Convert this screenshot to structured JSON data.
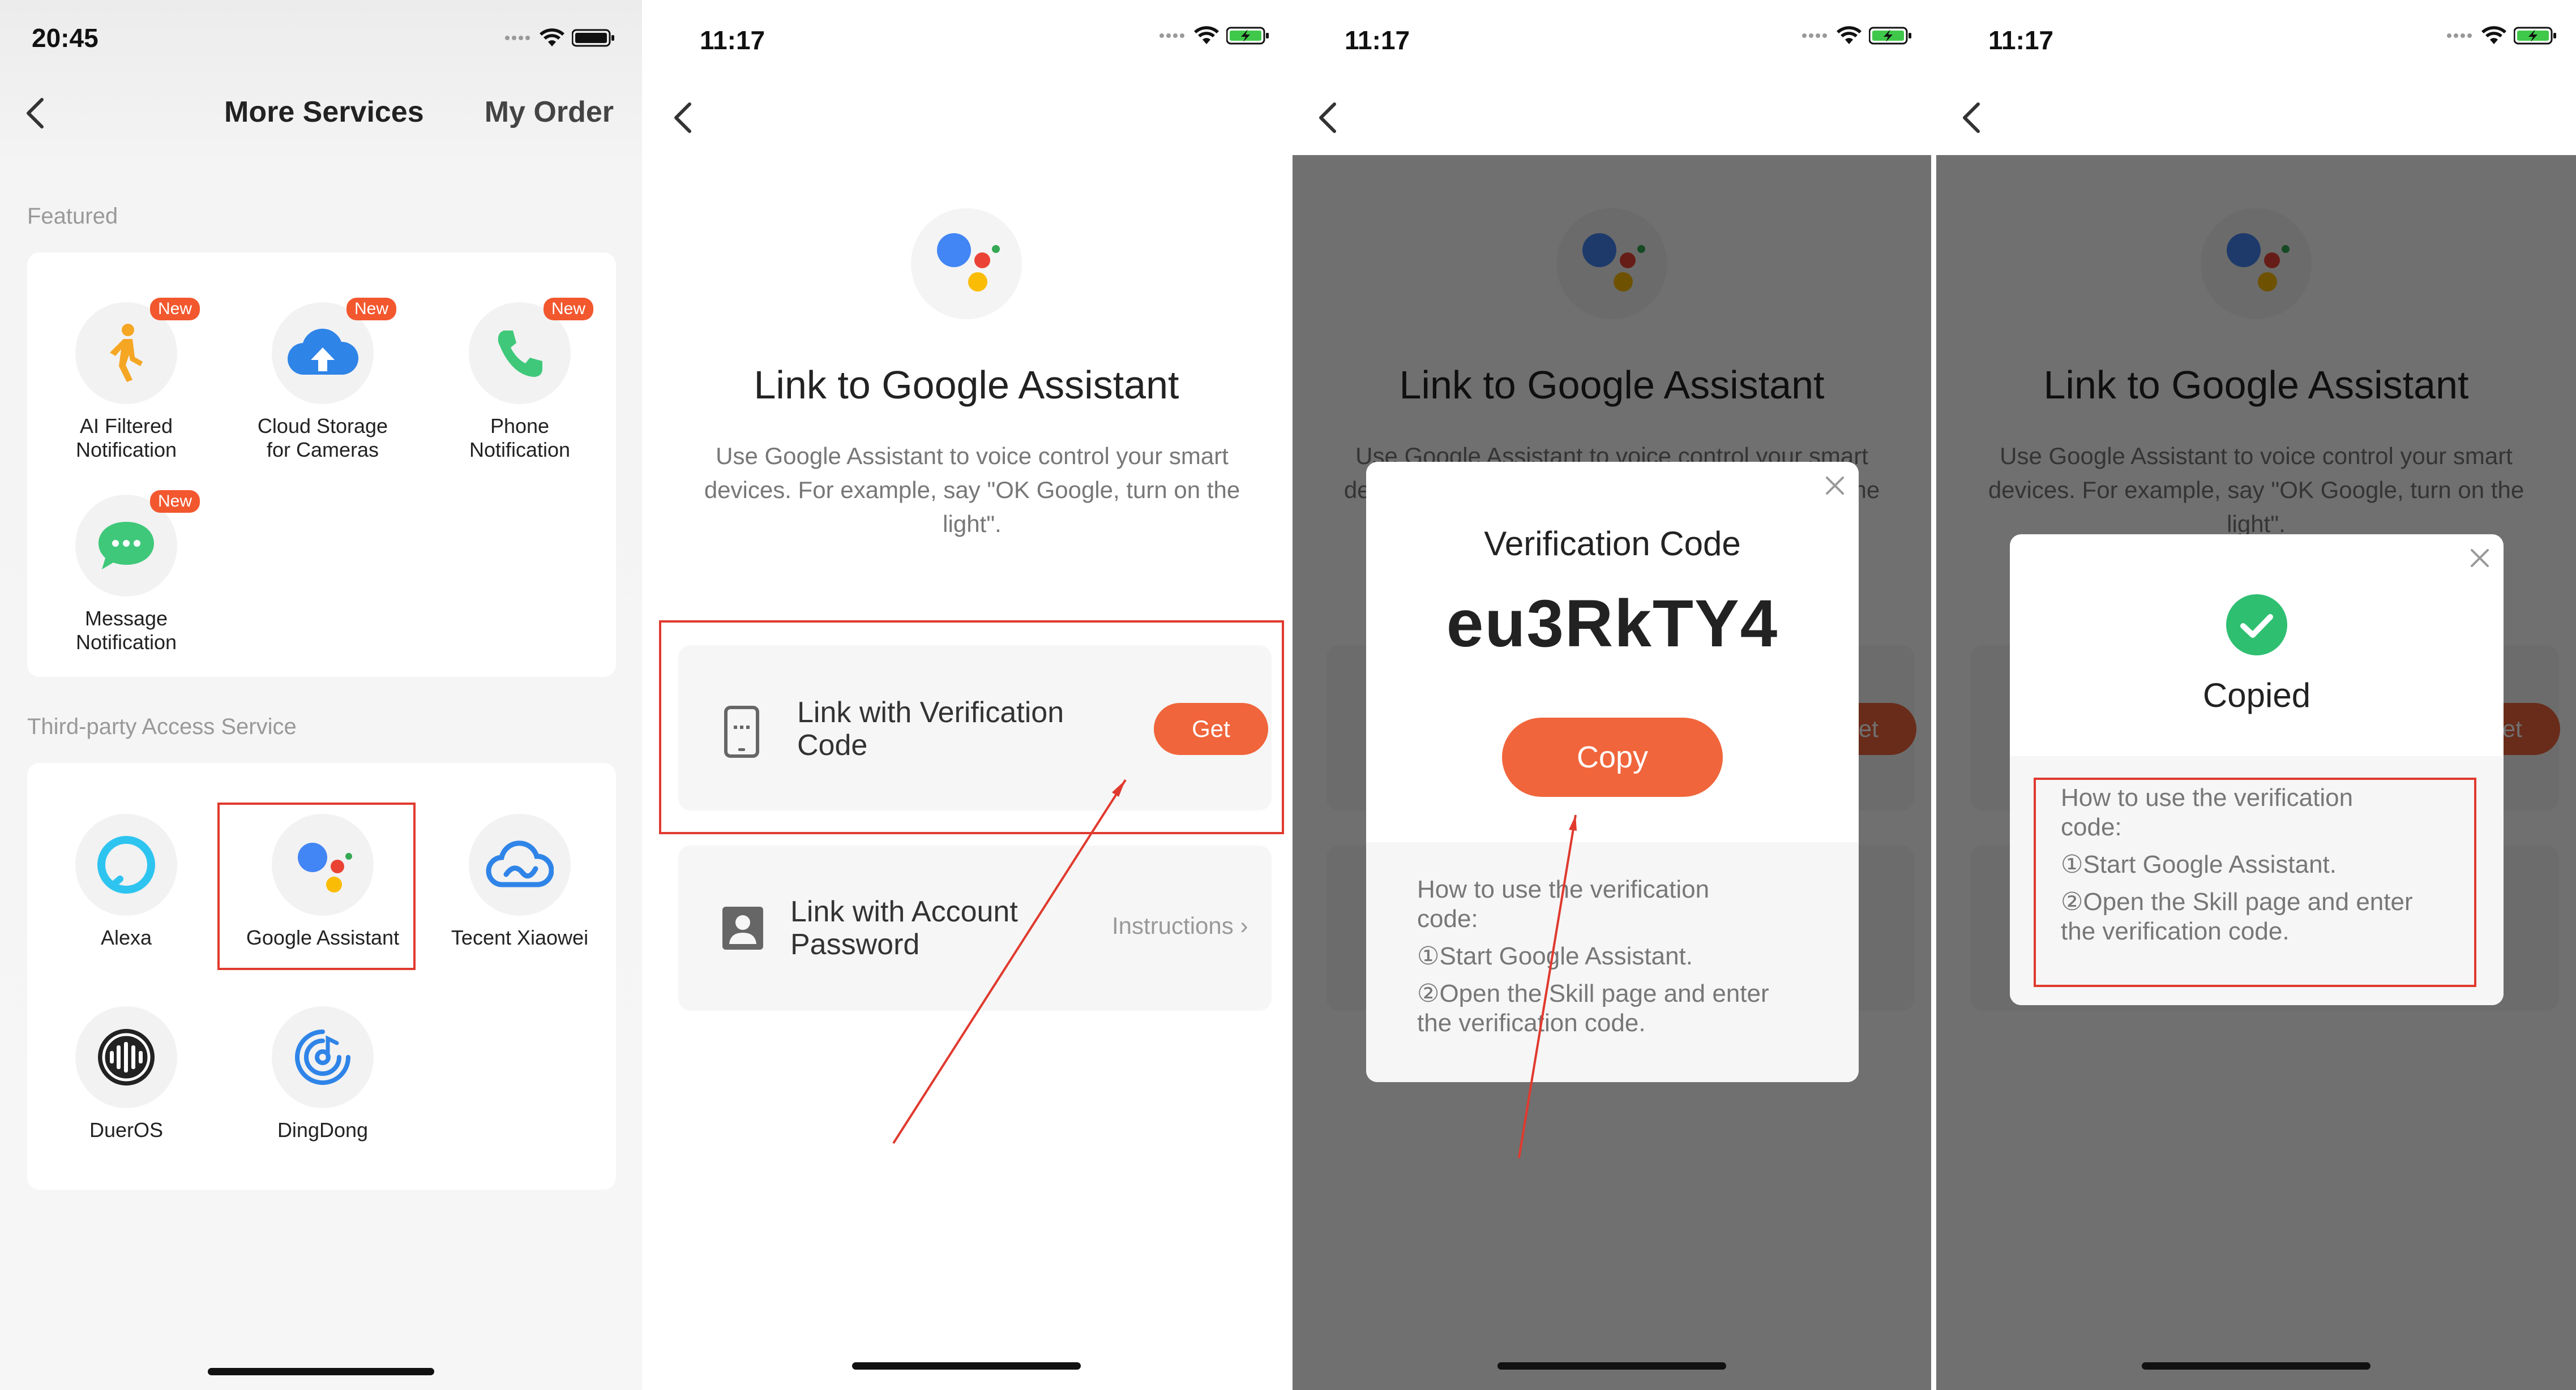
{
  "screen1": {
    "time": "20:45",
    "nav": {
      "title": "More Services",
      "right": "My Order"
    },
    "featured_label": "Featured",
    "featured": [
      {
        "label_l1": "AI Filtered",
        "label_l2": "Notification",
        "badge": "New"
      },
      {
        "label_l1": "Cloud Storage",
        "label_l2": "for Cameras",
        "badge": "New"
      },
      {
        "label_l1": "Phone",
        "label_l2": "Notification",
        "badge": "New"
      },
      {
        "label_l1": "Message",
        "label_l2": "Notification",
        "badge": "New"
      }
    ],
    "third_party_label": "Third-party Access Service",
    "third_party": [
      {
        "label": "Alexa"
      },
      {
        "label": "Google Assistant"
      },
      {
        "label": "Tecent Xiaowei"
      },
      {
        "label": "DuerOS"
      },
      {
        "label": "DingDong"
      }
    ]
  },
  "link_page": {
    "time": "11:17",
    "title": "Link to Google Assistant",
    "description": "Use Google Assistant to voice control your smart devices. For example, say \"OK Google, turn on the light\".",
    "option1": {
      "title_l1": "Link with Verification",
      "title_l2": "Code",
      "button": "Get"
    },
    "option2": {
      "title_l1": "Link with Account",
      "title_l2": "Password",
      "link": "Instructions"
    }
  },
  "screen3": {
    "modal_title": "Verification Code",
    "code": "eu3RkTY4",
    "copy_button": "Copy",
    "howto_title_l1": "How to use the verification",
    "howto_title_l2": "code:",
    "step1": "①Start Google Assistant.",
    "step2_l1": "②Open the Skill page and enter",
    "step2_l2": "the verification code."
  },
  "screen4": {
    "modal_title": "Copied",
    "howto_title_l1": "How to use the verification",
    "howto_title_l2": "code:",
    "step1": "①Start Google Assistant.",
    "step2_l1": "②Open the Skill page and enter",
    "step2_l2": "the verification code."
  },
  "colors": {
    "accent": "#f0653b",
    "highlight": "#e03a2e",
    "badge": "#f2572e",
    "success": "#2fbf71"
  }
}
